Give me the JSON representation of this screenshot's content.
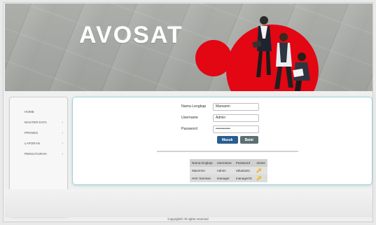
{
  "header": {
    "logo_text": "AVOSAT",
    "brand_color": "#e30613"
  },
  "sidebar": {
    "items": [
      {
        "label": "HOME",
        "has_children": false
      },
      {
        "label": "MASTER DATA",
        "has_children": true,
        "icon": "chevron-right-icon"
      },
      {
        "label": "PROSES",
        "has_children": true,
        "icon": "chevron-right-icon"
      },
      {
        "label": "LAPORAN",
        "has_children": true,
        "icon": "chevron-right-icon"
      },
      {
        "label": "PENGATURAN",
        "has_children": true,
        "icon": "chevron-right-icon"
      }
    ]
  },
  "login": {
    "fullname_label": "Nama Lengkap",
    "fullname_value": "Mamamn",
    "username_label": "Username",
    "username_value": "Admin",
    "password_label": "Password",
    "password_value": "••••••••••••",
    "login_button": "Masuk",
    "cancel_button": "Batal"
  },
  "credentials": {
    "columns": [
      "Nama lengkap",
      "Username",
      "Password",
      "Akses"
    ],
    "rows": [
      [
        "Manzmm",
        "Admin",
        "rahasia01",
        "key-icon"
      ],
      [
        "Herr Samsan",
        "manager",
        "manager01",
        "key-icon"
      ]
    ]
  },
  "footer": {
    "copyright": "Copyright© All rights reserved"
  }
}
